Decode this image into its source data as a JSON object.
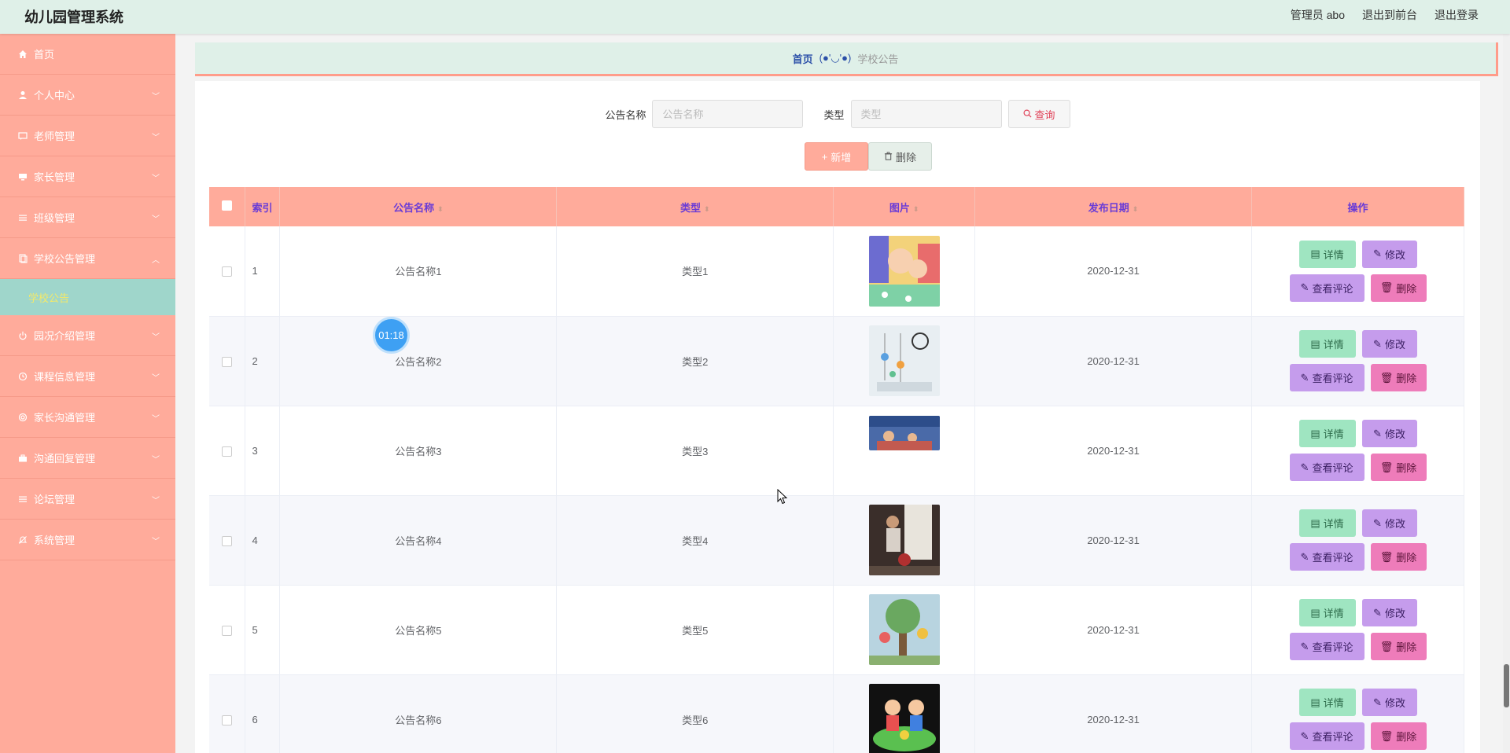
{
  "header": {
    "app_title": "幼儿园管理系统",
    "admin_label": "管理员 abo",
    "front_link": "退出到前台",
    "logout_link": "退出登录"
  },
  "sidebar": {
    "items": [
      {
        "label": "首页",
        "icon": "home-icon"
      },
      {
        "label": "个人中心",
        "icon": "user-icon"
      },
      {
        "label": "老师管理",
        "icon": "chat-icon"
      },
      {
        "label": "家长管理",
        "icon": "monitor-icon"
      },
      {
        "label": "班级管理",
        "icon": "list-icon"
      },
      {
        "label": "学校公告管理",
        "icon": "document-icon"
      },
      {
        "label": "园况介绍管理",
        "icon": "power-icon"
      },
      {
        "label": "课程信息管理",
        "icon": "clock-icon"
      },
      {
        "label": "家长沟通管理",
        "icon": "target-icon"
      },
      {
        "label": "沟通回复管理",
        "icon": "briefcase-icon"
      },
      {
        "label": "论坛管理",
        "icon": "list-icon"
      },
      {
        "label": "系统管理",
        "icon": "bell-off-icon"
      }
    ],
    "submenu_active": "学校公告"
  },
  "breadcrumb": {
    "home": "首页",
    "separator": "(●'◡'●)",
    "current": "学校公告"
  },
  "search": {
    "name_label": "公告名称",
    "name_placeholder": "公告名称",
    "type_label": "类型",
    "type_placeholder": "类型",
    "query_button": "查询"
  },
  "actions": {
    "add_button": "新增",
    "delete_button": "删除"
  },
  "table": {
    "columns": [
      "索引",
      "公告名称",
      "类型",
      "图片",
      "发布日期",
      "操作"
    ],
    "rows": [
      {
        "index": "1",
        "name": "公告名称1",
        "type": "类型1",
        "date": "2020-12-31"
      },
      {
        "index": "2",
        "name": "公告名称2",
        "type": "类型2",
        "date": "2020-12-31"
      },
      {
        "index": "3",
        "name": "公告名称3",
        "type": "类型3",
        "date": "2020-12-31"
      },
      {
        "index": "4",
        "name": "公告名称4",
        "type": "类型4",
        "date": "2020-12-31"
      },
      {
        "index": "5",
        "name": "公告名称5",
        "type": "类型5",
        "date": "2020-12-31"
      },
      {
        "index": "6",
        "name": "公告名称6",
        "type": "类型6",
        "date": "2020-12-31"
      }
    ],
    "row_actions": {
      "detail": "详情",
      "edit": "修改",
      "comment": "查看评论",
      "delete": "删除"
    }
  },
  "timer": "01:18",
  "colors": {
    "header_bg": "#dff0e8",
    "sidebar_bg": "#ffab9b",
    "submenu_bg": "#9fd6cb",
    "table_header_bg": "#ffab9b",
    "detail_btn": "#9fe5c1",
    "edit_btn": "#c59cec",
    "delete_btn": "#ee7cba"
  }
}
